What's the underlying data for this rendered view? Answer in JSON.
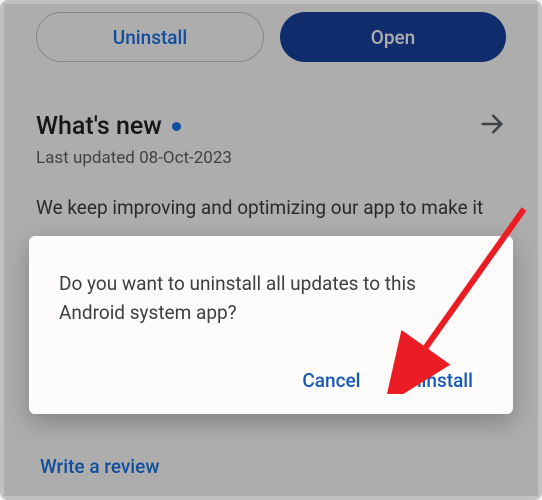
{
  "buttons": {
    "uninstall": "Uninstall",
    "open": "Open"
  },
  "whatsnew": {
    "title": "What's new",
    "updated": "Last updated 08-Oct-2023",
    "description": "We keep improving and optimizing our app to make it"
  },
  "review": {
    "write": "Write a review"
  },
  "dialog": {
    "message": "Do you want to uninstall all updates to this Android system app?",
    "cancel": "Cancel",
    "confirm": "Uninstall"
  }
}
